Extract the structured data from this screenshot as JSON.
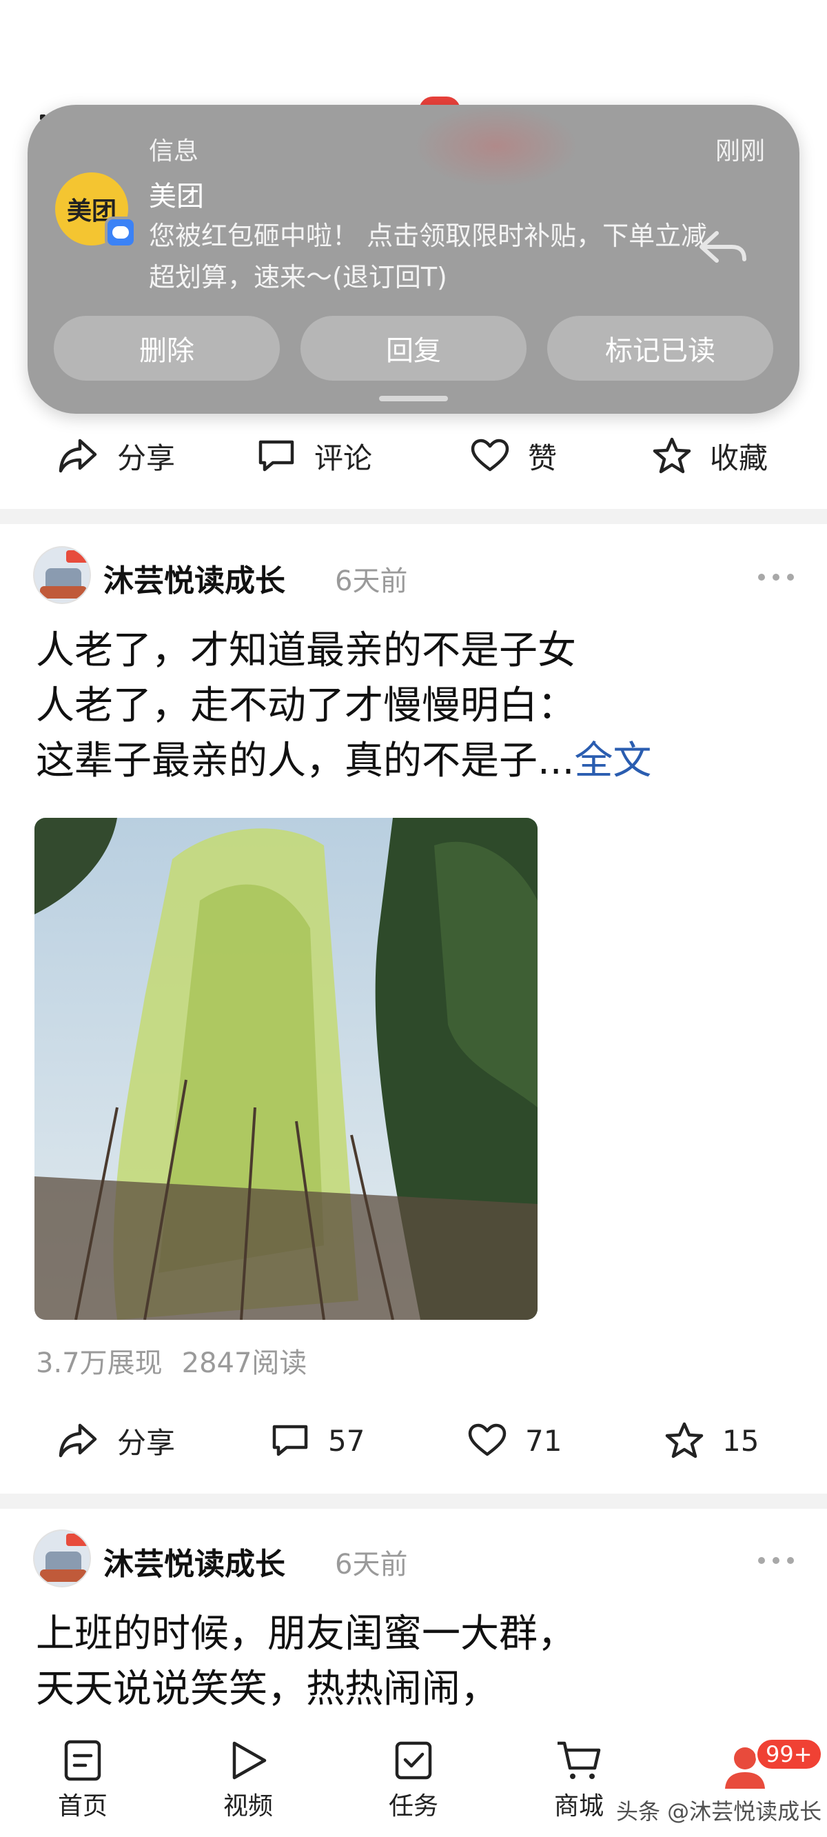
{
  "notification": {
    "app_label": "信息",
    "time": "刚刚",
    "avatar_text": "美团",
    "sender": "美团",
    "body": "您被红包砸中啦！ 点击领取限时补贴，下单立减超划算，速来～(退订回T)",
    "actions": [
      "删除",
      "回复",
      "标记已读"
    ]
  },
  "top_action_bar": {
    "share": "分享",
    "comment": "评论",
    "like": "赞",
    "favorite": "收藏"
  },
  "post1": {
    "author": "沐芸悦读成长",
    "time": "6天前",
    "lines": [
      "人老了，才知道最亲的不是子女",
      "人老了，走不动了才慢慢明白：",
      "这辈子最亲的人，真的不是子..."
    ],
    "full_text_link": "全文",
    "stats_impressions": "3.7万展现",
    "stats_reads": "2847阅读",
    "share": "分享",
    "comments": "57",
    "likes": "71",
    "favorites": "15"
  },
  "post2": {
    "author": "沐芸悦读成长",
    "time": "6天前",
    "lines": [
      "上班的时候，朋友闺蜜一大群，",
      "天天说说笑笑，热热闹闹，"
    ]
  },
  "bottom_nav": {
    "items": [
      "首页",
      "视频",
      "任务",
      "商城"
    ],
    "badge": "99+",
    "watermark": "头条 @沐芸悦读成长"
  },
  "colors": {
    "accent_link": "#2a5db0",
    "badge_red": "#f04134",
    "meituan_yellow": "#f4c531"
  }
}
